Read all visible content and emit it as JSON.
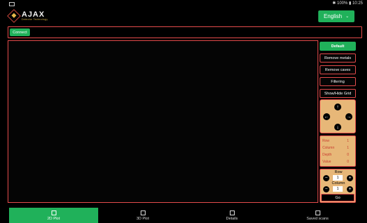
{
  "status_bar": {
    "right_text": "✱ 100% ▮ 10:25"
  },
  "header": {
    "brand": "AJAX",
    "tagline": "Detector Technology",
    "language_label": "English",
    "language_chevron": "⌄"
  },
  "connection": {
    "connect_label": "Connect"
  },
  "controls": {
    "default_label": "Default",
    "remove_metals_label": "Remove metals",
    "remove_caves_label": "Remove caves",
    "filtering_label": "Filtering",
    "grid_label": "Show/Hide Grid"
  },
  "dpad": {
    "up": "↑",
    "down": "↓",
    "left": "←",
    "right": "→"
  },
  "info": {
    "row_label": "Row",
    "row_value": "1",
    "column_label": "Column",
    "column_value": "1",
    "depth_label": "Depth",
    "depth_value": "0",
    "value_label": "Value",
    "value_value": "0"
  },
  "selector": {
    "row_label": "Row",
    "row_value": "1",
    "column_label": "Column",
    "column_value": "1",
    "minus": "−",
    "plus": "+",
    "go_label": "Go"
  },
  "bottom_nav": {
    "tabs": [
      {
        "label": "2D Plot",
        "icon": "grid-icon",
        "active": true
      },
      {
        "label": "3D Plot",
        "icon": "grid-3d-icon",
        "active": false
      },
      {
        "label": "Details",
        "icon": "clipboard-icon",
        "active": false
      },
      {
        "label": "Saved scans",
        "icon": "archive-icon",
        "active": false
      }
    ]
  },
  "colors": {
    "accent": "#20b15a",
    "border": "#e54b4b",
    "panel": "#e7b778",
    "info_text": "#c73b2e"
  }
}
